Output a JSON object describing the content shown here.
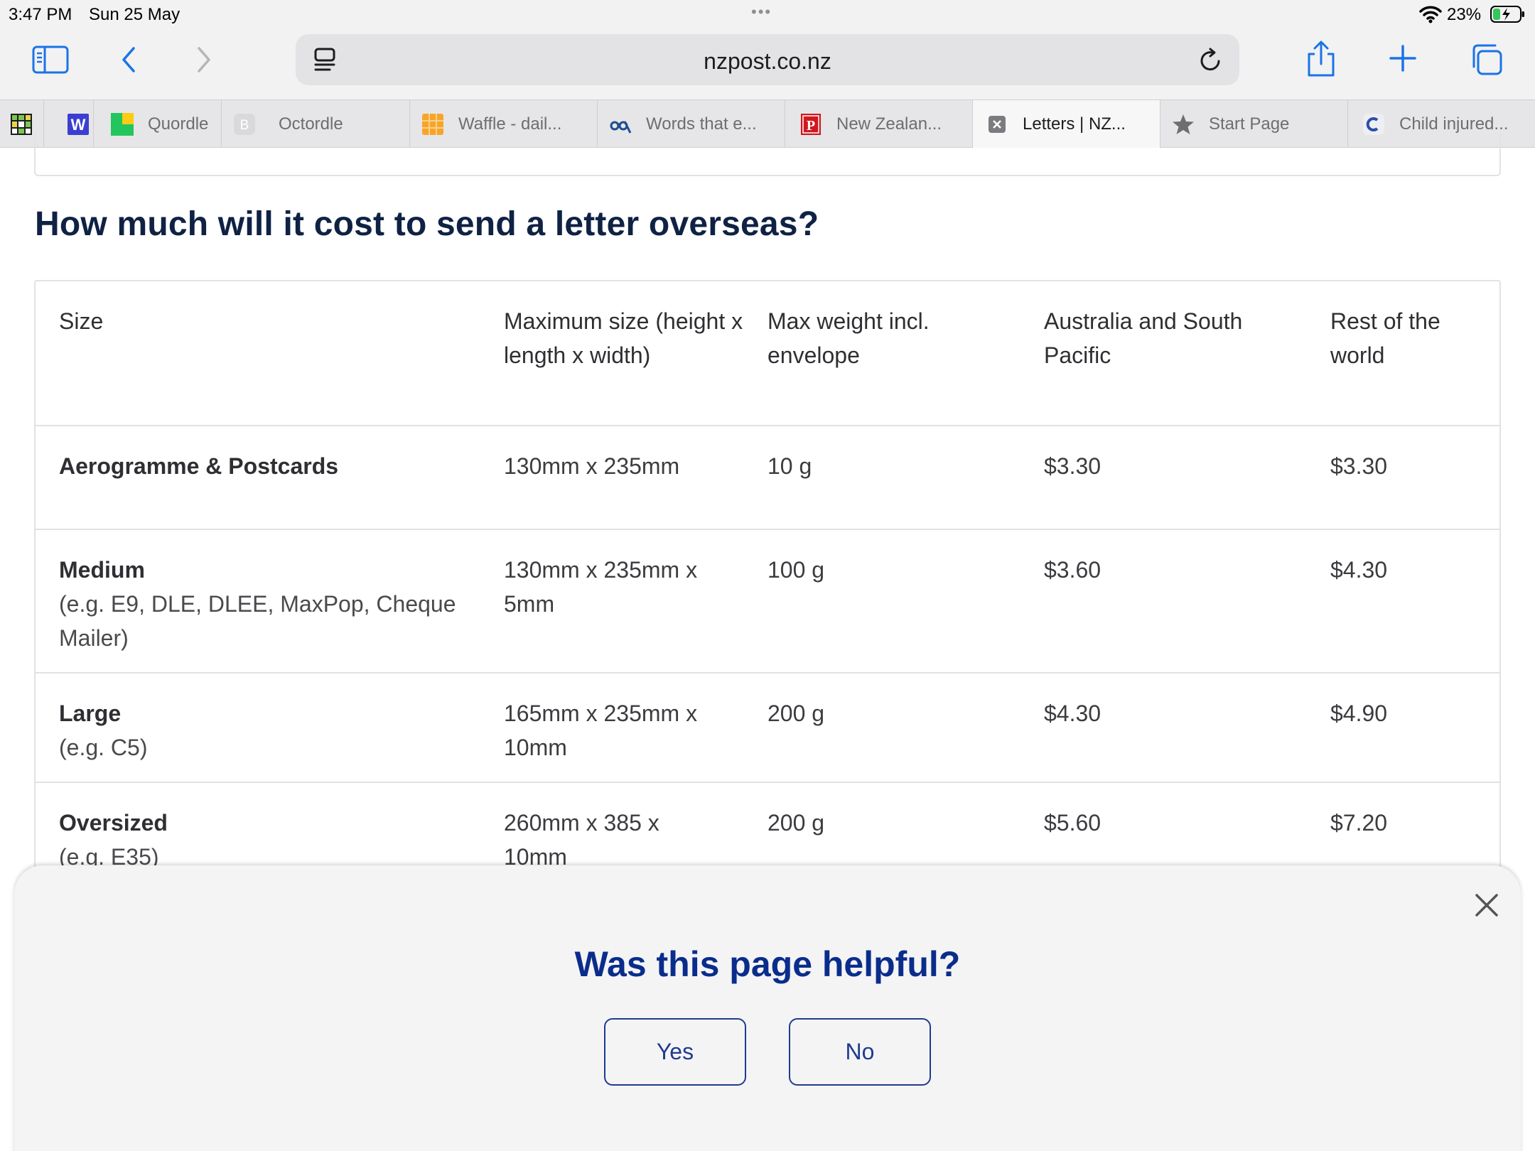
{
  "status_bar": {
    "time": "3:47 PM",
    "date": "Sun 25 May",
    "multitask_dots": "•••",
    "battery_pct": "23%"
  },
  "toolbar": {
    "url": "nzpost.co.nz"
  },
  "tabs": [
    {
      "label": "",
      "icon": "grid-game-icon"
    },
    {
      "label": "",
      "icon": "w-letter-icon"
    },
    {
      "label": "Quordle",
      "icon": "quordle-icon"
    },
    {
      "label": "Octordle",
      "icon": "b-letter-icon"
    },
    {
      "label": "Waffle - dail...",
      "icon": "waffle-icon"
    },
    {
      "label": "Words that e...",
      "icon": "binoculars-icon"
    },
    {
      "label": "New Zealan...",
      "icon": "p-letter-icon"
    },
    {
      "label": "Letters | NZ...",
      "icon": "close-icon"
    },
    {
      "label": "Start Page",
      "icon": "star-icon"
    },
    {
      "label": "Child injured...",
      "icon": "c-letter-icon"
    }
  ],
  "main": {
    "heading": "How much will it cost to send a letter overseas?",
    "table": {
      "headers": [
        "Size",
        "Maximum size (height x length x width)",
        "Max weight incl. envelope",
        "Australia and South Pacific",
        "Rest of the world"
      ],
      "rows": [
        {
          "size": "Aerogramme & Postcards",
          "example": "",
          "max_size": "130mm x 235mm",
          "weight": "10 g",
          "aus_sp": "$3.30",
          "rest": "$3.30"
        },
        {
          "size": "Medium",
          "example": "(e.g. E9, DLE, DLEE, MaxPop, Cheque Mailer)",
          "max_size": "130mm x 235mm x 5mm",
          "weight": "100 g",
          "aus_sp": "$3.60",
          "rest": "$4.30"
        },
        {
          "size": "Large",
          "example": "(e.g. C5)",
          "max_size": "165mm x 235mm x 10mm",
          "weight": "200 g",
          "aus_sp": "$4.30",
          "rest": "$4.90"
        },
        {
          "size": "Oversized",
          "example": "(e.g. E35)",
          "max_size": "260mm x 385 x 10mm",
          "weight": "200 g",
          "aus_sp": "$5.60",
          "rest": "$7.20"
        }
      ]
    }
  },
  "feedback": {
    "question": "Was this page helpful?",
    "yes_label": "Yes",
    "no_label": "No"
  },
  "colors": {
    "accent": "#1a73e8",
    "heading": "#0f2244",
    "feedback_blue": "#0a2d8c"
  }
}
